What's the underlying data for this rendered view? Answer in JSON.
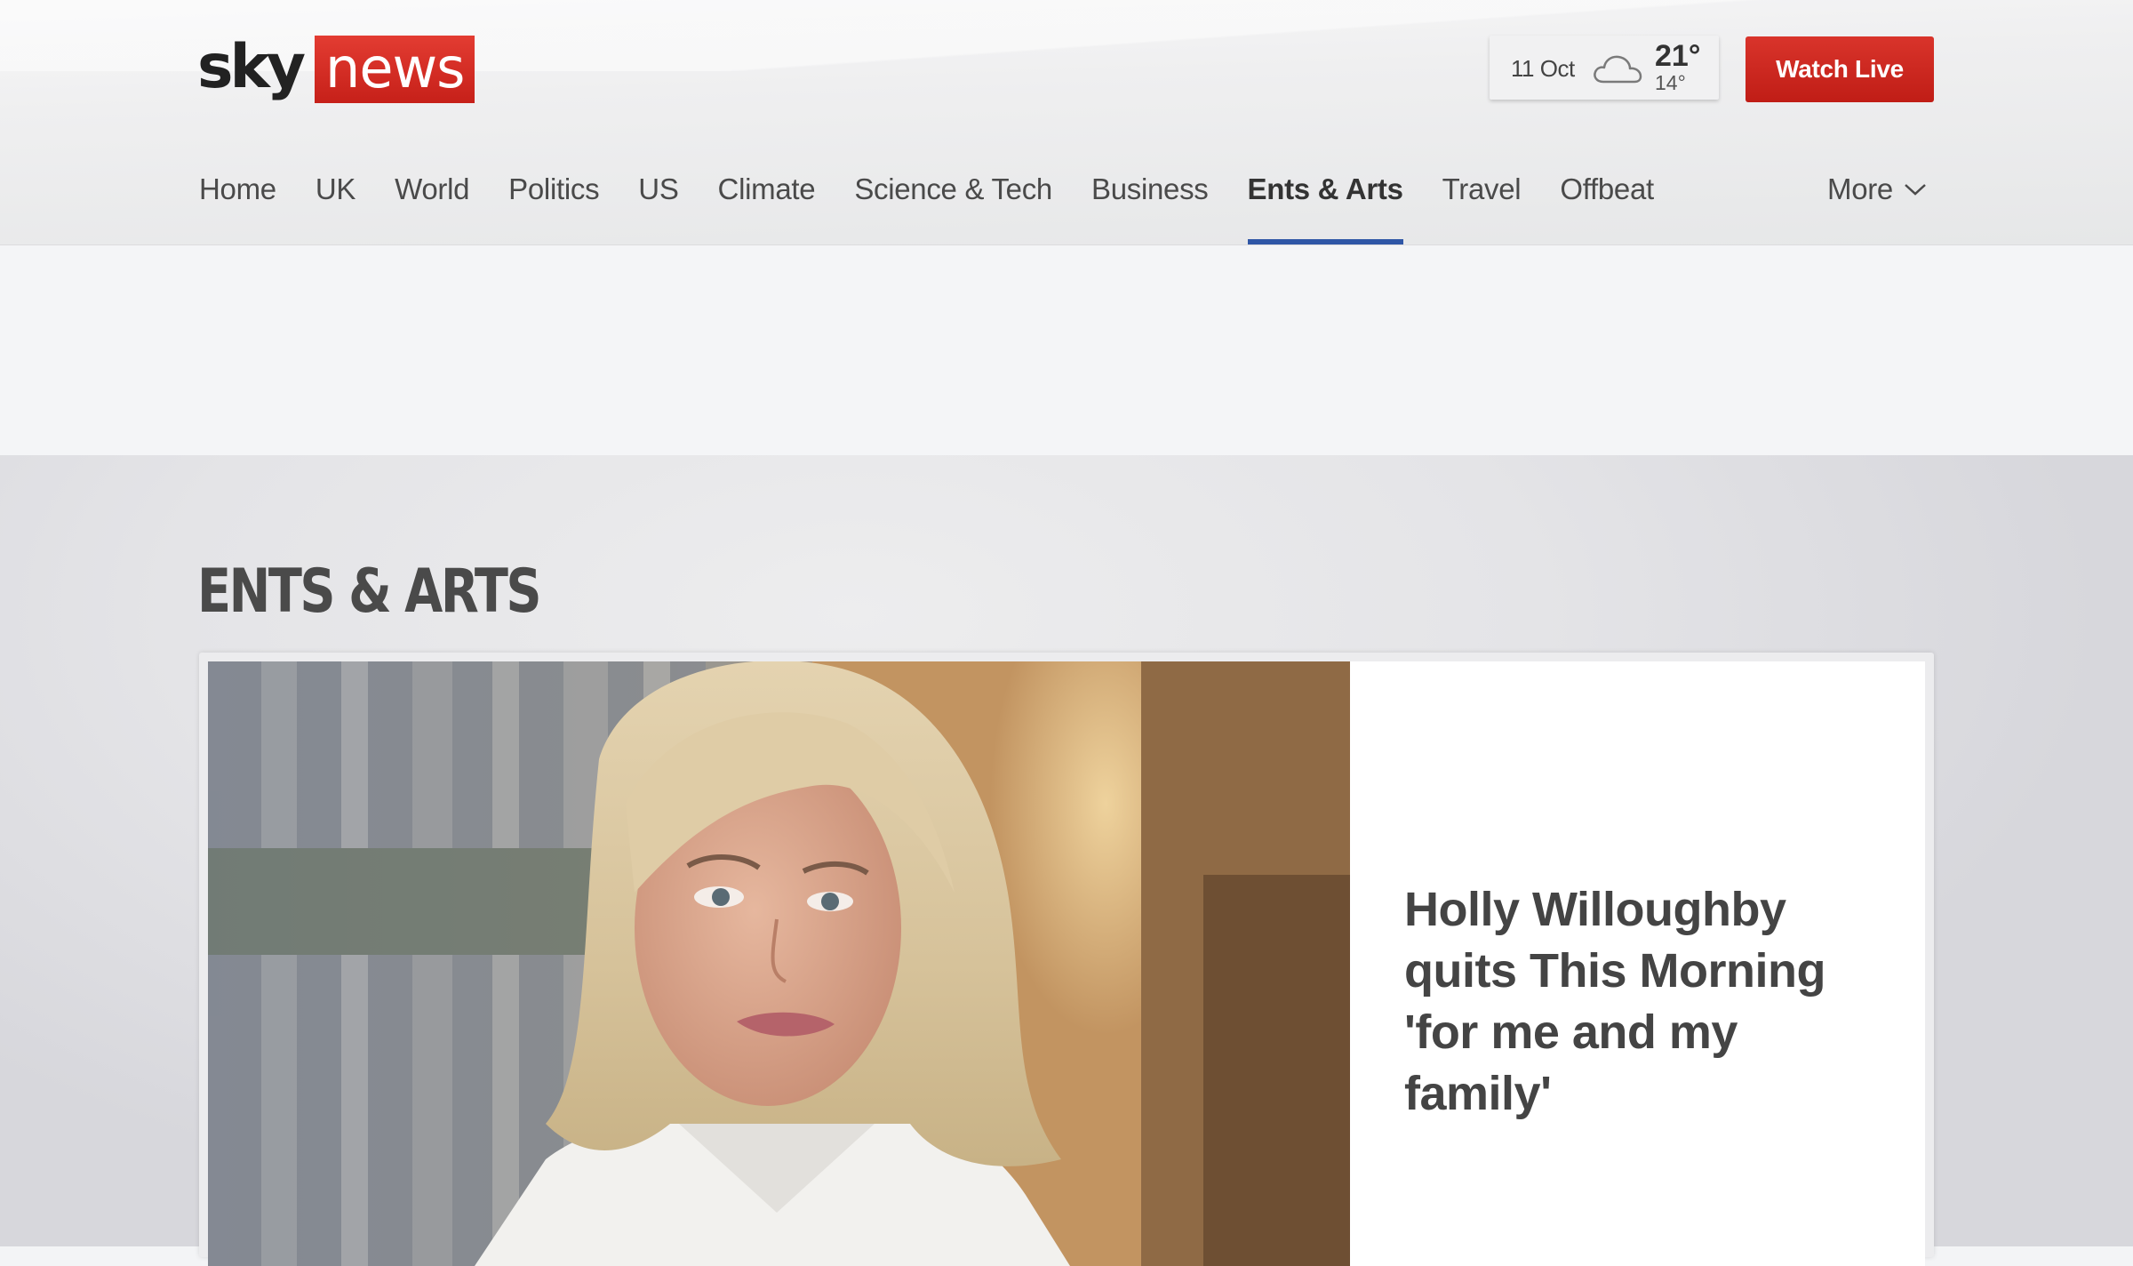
{
  "header": {
    "logo": {
      "sky": "sky",
      "news": "news"
    },
    "weather": {
      "date": "11 Oct",
      "icon": "cloud-icon",
      "high": "21°",
      "low": "14°"
    },
    "watch_live_label": "Watch Live"
  },
  "nav": {
    "items": [
      {
        "label": "Home"
      },
      {
        "label": "UK"
      },
      {
        "label": "World"
      },
      {
        "label": "Politics"
      },
      {
        "label": "US"
      },
      {
        "label": "Climate"
      },
      {
        "label": "Science & Tech"
      },
      {
        "label": "Business"
      },
      {
        "label": "Ents & Arts",
        "active": true
      },
      {
        "label": "Travel"
      },
      {
        "label": "Offbeat"
      }
    ],
    "more_label": "More"
  },
  "section": {
    "title": "ENTS & ARTS",
    "lead_story": {
      "headline": "Holly Willoughby quits This Morning 'for me and my family'"
    }
  },
  "colors": {
    "brand_red": "#c62019",
    "nav_active_underline": "#2f56a6",
    "text_dark": "#444444"
  }
}
